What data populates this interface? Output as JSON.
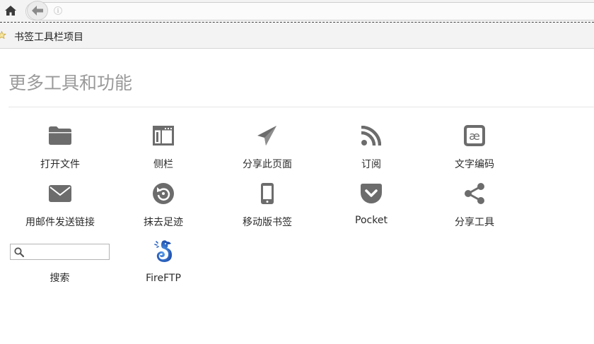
{
  "toolbar": {
    "home_icon": "home-icon",
    "back_icon": "back-arrow-icon",
    "info_icon": "info-icon"
  },
  "bookmarks_bar": {
    "label": "书签工具栏项目"
  },
  "panel": {
    "title": "更多工具和功能",
    "tools": [
      {
        "label": "打开文件",
        "icon": "folder-icon"
      },
      {
        "label": "侧栏",
        "icon": "sidebar-icon"
      },
      {
        "label": "分享此页面",
        "icon": "paper-plane-icon"
      },
      {
        "label": "订阅",
        "icon": "rss-icon"
      },
      {
        "label": "文字编码",
        "icon": "character-encoding-icon"
      },
      {
        "label": "用邮件发送链接",
        "icon": "envelope-icon"
      },
      {
        "label": "抹去足迹",
        "icon": "forget-icon"
      },
      {
        "label": "移动版书签",
        "icon": "mobile-phone-icon"
      },
      {
        "label": "Pocket",
        "icon": "pocket-icon"
      },
      {
        "label": "分享工具",
        "icon": "share-icon"
      }
    ],
    "search": {
      "label": "搜索",
      "placeholder": "",
      "value": ""
    },
    "fireftp": {
      "label": "FireFTP",
      "icon": "fireftp-seahorse-icon"
    }
  },
  "colors": {
    "icon_gray": "#6c6c6c",
    "title_gray": "#9a9a9a",
    "toolbar_bg": "#f3f3f3"
  }
}
